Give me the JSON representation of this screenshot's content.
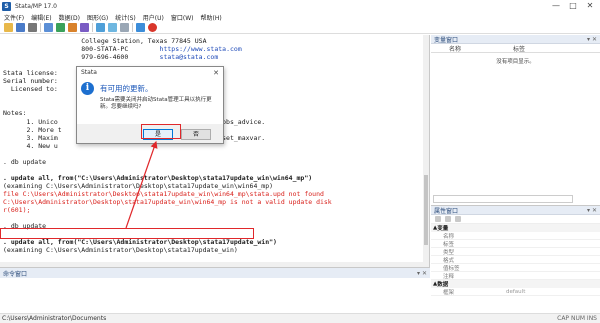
{
  "window": {
    "title": "Stata/MP 17.0",
    "icon_letter": "S",
    "controls": [
      "—",
      "□",
      "✕"
    ]
  },
  "menu": [
    "文件(F)",
    "编辑(E)",
    "数据(D)",
    "图形(G)",
    "统计(S)",
    "用户(U)",
    "窗口(W)",
    "帮助(H)"
  ],
  "results": {
    "lines": [
      {
        "text": "                    College Station, Texas 77845 USA",
        "style": "blk"
      },
      {
        "text": "                    800-STATA-PC        https://www.stata.com",
        "style": "blk"
      },
      {
        "text": "                    979-696-4600        stata@stata.com",
        "style": "blk"
      },
      {
        "text": "",
        "style": "blk"
      },
      {
        "text": "Stata license:",
        "style": "blk"
      },
      {
        "text": "Serial number:",
        "style": "blk"
      },
      {
        "text": "  Licensed to:",
        "style": "blk"
      },
      {
        "text": "",
        "style": "blk"
      },
      {
        "text": "",
        "style": "blk"
      },
      {
        "text": "Notes:",
        "style": "blk"
      },
      {
        "text": "      1. Unico                                          obs_advice.",
        "style": "blk"
      },
      {
        "text": "      2. More t                                          ",
        "style": "blk"
      },
      {
        "text": "      3. Maxim                                          set_maxvar.",
        "style": "blk"
      },
      {
        "text": "      4. New u",
        "style": "blk"
      },
      {
        "text": "",
        "style": "blk"
      },
      {
        "text": ". db update",
        "style": "blk"
      },
      {
        "text": "",
        "style": "blk"
      },
      {
        "text": ". update all, from(\"C:\\Users\\Administrator\\Desktop\\stata17update_win\\win64_mp\")",
        "style": "blk bold"
      },
      {
        "text": "(examining C:\\Users\\Administrator\\Desktop\\stata17update_win\\win64_mp)",
        "style": "blk"
      },
      {
        "text": "file C:\\Users\\Administrator\\Desktop\\stata17update_win\\win64_mp\\stata.upd not found",
        "style": "red"
      },
      {
        "text": "C:\\Users\\Administrator\\Desktop\\stata17update_win\\win64_mp is not a valid update disk",
        "style": "red"
      },
      {
        "text": "r(601);",
        "style": "red"
      },
      {
        "text": "",
        "style": "blk"
      },
      {
        "text": ". db update",
        "style": "blk"
      },
      {
        "text": "",
        "style": "blk"
      },
      {
        "text": ". update all, from(\"C:\\Users\\Administrator\\Desktop\\stata17update_win\")",
        "style": "blk bold"
      },
      {
        "text": "(examining C:\\Users\\Administrator\\Desktop\\stata17update_win)",
        "style": "blk"
      }
    ]
  },
  "command_pane": {
    "title": "命令窗口"
  },
  "variables_pane": {
    "title": "变量窗口",
    "columns": [
      "名称",
      "标签"
    ],
    "empty_text": "没有项目显示。"
  },
  "properties_pane": {
    "title": "属性窗口",
    "groups": [
      {
        "name": "变量",
        "rows": [
          {
            "k": "名称",
            "v": ""
          },
          {
            "k": "标签",
            "v": ""
          },
          {
            "k": "类型",
            "v": ""
          },
          {
            "k": "格式",
            "v": ""
          },
          {
            "k": "值标签",
            "v": ""
          },
          {
            "k": "注释",
            "v": ""
          }
        ]
      },
      {
        "name": "数据",
        "rows": [
          {
            "k": "框架",
            "v": "default"
          }
        ]
      }
    ]
  },
  "status_bar": {
    "path": "C:\\Users\\Administrator\\Documents",
    "indicators": "CAP  NUM  INS"
  },
  "dialog": {
    "title": "Stata",
    "close": "✕",
    "icon_glyph": "i",
    "heading": "有可用的更新。",
    "message": "Stata需要关闭并启动Stata管理工具以执行更新。您要继续吗?",
    "yes_label": "是",
    "no_label": "否"
  },
  "colors": {
    "accent_blue": "#1a56b8",
    "error_red": "#d8201b",
    "annotation_red": "#e0282b"
  }
}
